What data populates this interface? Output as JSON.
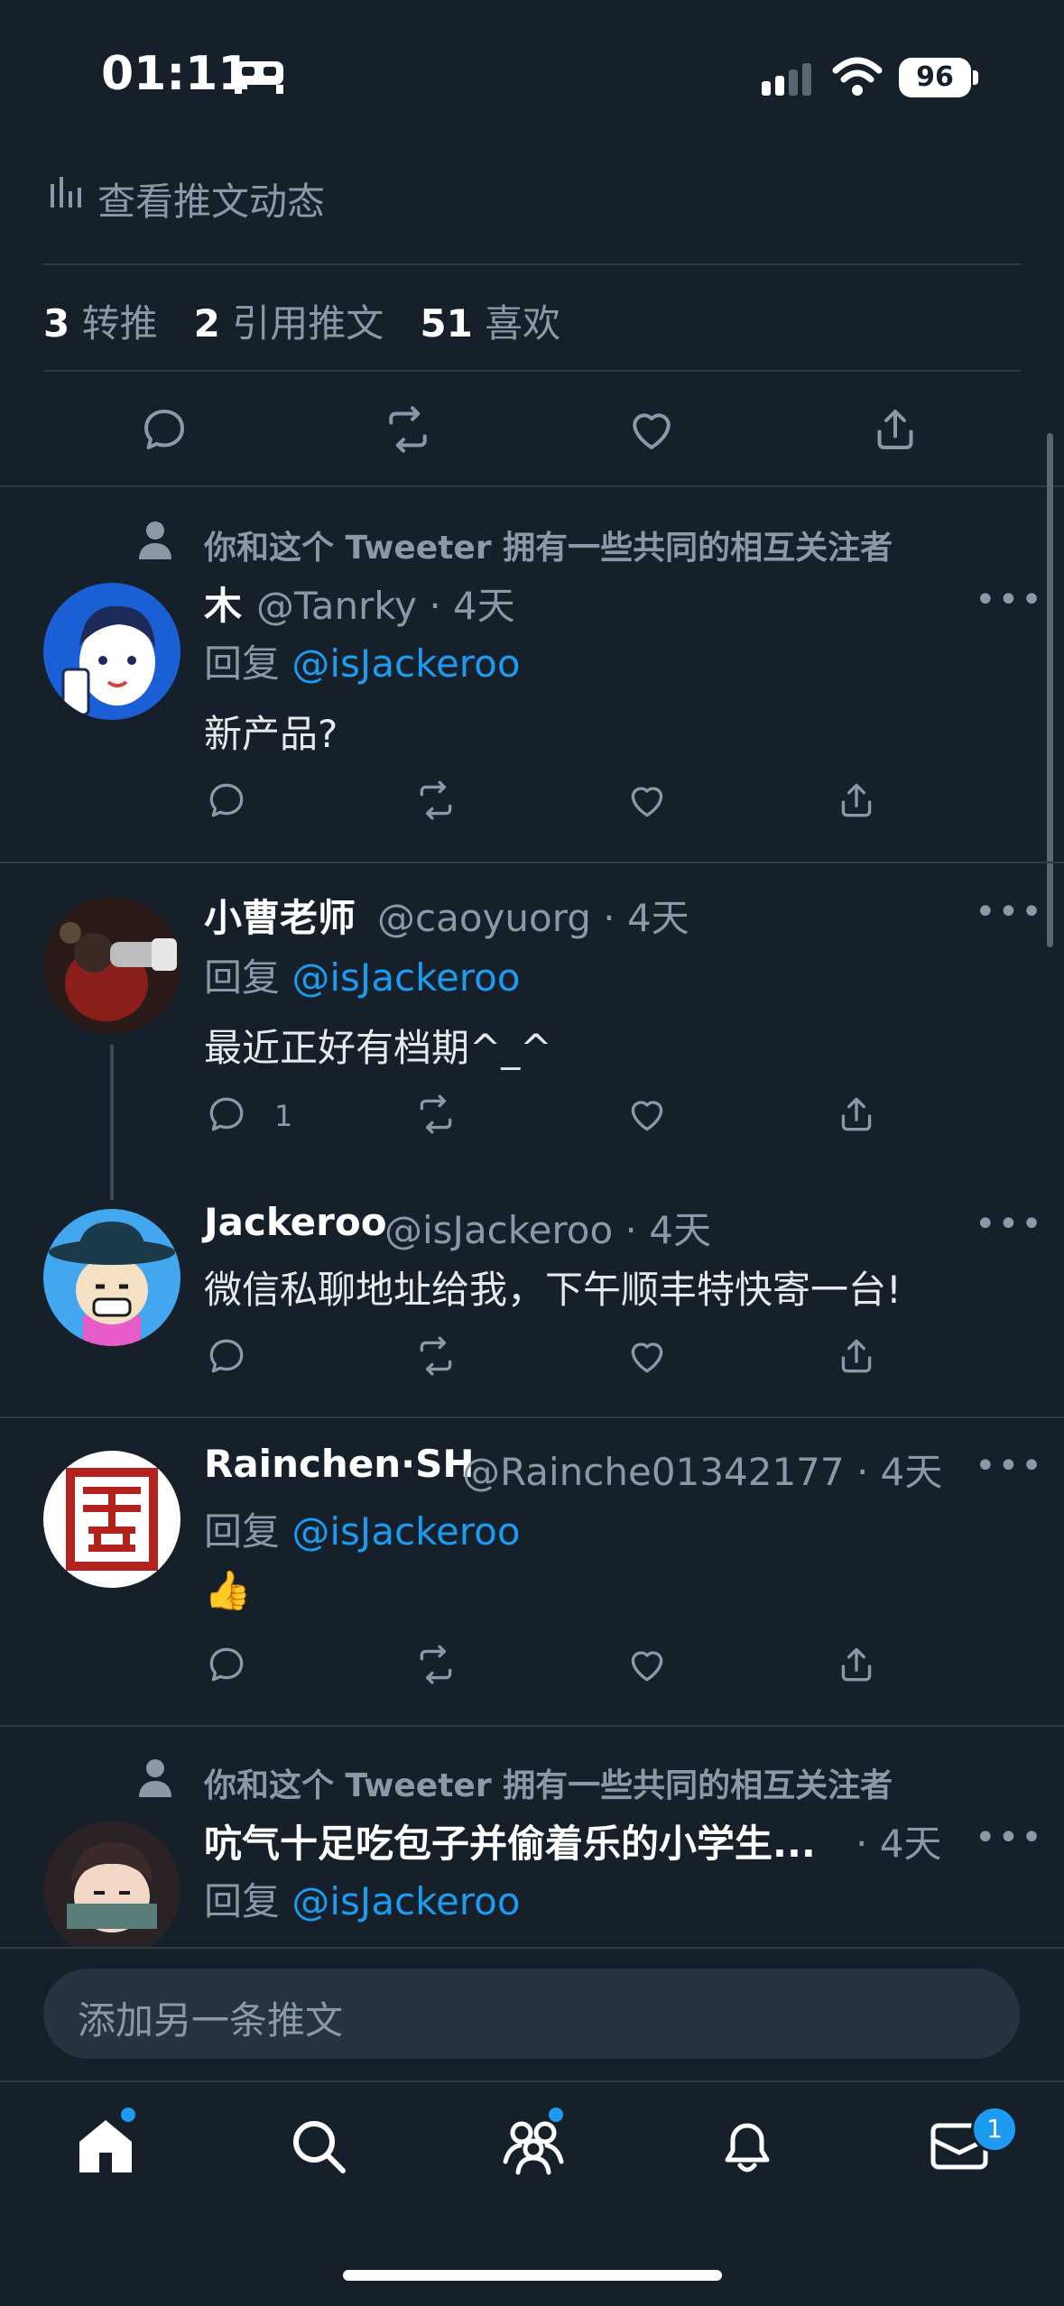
{
  "status_bar": {
    "time": "01:11",
    "battery": "96"
  },
  "tweet_activity": {
    "label": "查看推文动态"
  },
  "stats": {
    "retweets_count": "3",
    "retweets_label": "转推",
    "quotes_count": "2",
    "quotes_label": "引用推文",
    "likes_count": "51",
    "likes_label": "喜欢"
  },
  "replies": [
    {
      "social_context": "你和这个 Tweeter 拥有一些共同的相互关注者",
      "name": "木",
      "handle": "@Tanrky · 4天",
      "reply_prefix": "回复",
      "reply_to": "@isJackeroo",
      "text": "新产品?"
    },
    {
      "name": "小曹老师",
      "handle": "@caoyuorg · 4天",
      "reply_prefix": "回复",
      "reply_to": "@isJackeroo",
      "text": "最近正好有档期^_^",
      "reply_count": "1"
    },
    {
      "name": "Jackeroo",
      "handle": "@isJackeroo · 4天",
      "text": "微信私聊地址给我，下午顺丰特快寄一台!"
    },
    {
      "name": "Rainchen·SH",
      "handle": "@Rainche01342177 · 4天",
      "reply_prefix": "回复",
      "reply_to": "@isJackeroo",
      "text": "👍"
    },
    {
      "social_context": "你和这个 Tweeter 拥有一些共同的相互关注者",
      "name": "吭气十足吃包子并偷着乐的小学生...",
      "handle": "· 4天",
      "reply_prefix": "回复",
      "reply_to": "@isJackeroo"
    }
  ],
  "compose": {
    "placeholder": "添加另一条推文"
  },
  "tab_bar": {
    "messages_badge": "1"
  }
}
